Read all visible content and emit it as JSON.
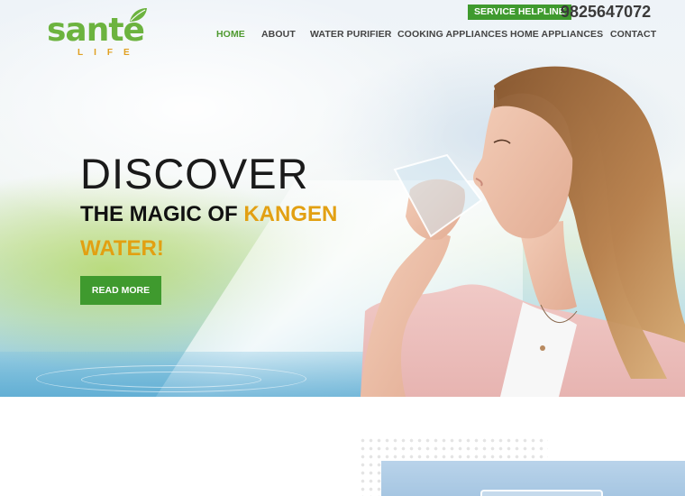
{
  "brand": {
    "name": "santé",
    "subtitle": "LIFE",
    "colors": {
      "green": "#6cb33f",
      "orange": "#e0a020"
    }
  },
  "helpline": {
    "label": "SERVICE HELPLINE",
    "number": "9825647072"
  },
  "nav": {
    "items": [
      {
        "label": "HOME",
        "active": true
      },
      {
        "label": "ABOUT",
        "active": false
      },
      {
        "label": "WATER PURIFIER",
        "active": false
      },
      {
        "label": "COOKING APPLIANCES",
        "active": false
      },
      {
        "label": "HOME APPLIANCES",
        "active": false
      },
      {
        "label": "CONTACT",
        "active": false
      }
    ]
  },
  "hero": {
    "heading": "DISCOVER",
    "line2_prefix": "THE MAGIC OF",
    "line2_accent": "KANGEN",
    "line3": "WATER!",
    "cta_label": "READ MORE",
    "image": "woman-drinking-water"
  },
  "theme": {
    "primary_green": "#3f9a2e",
    "accent_orange": "#e2a012",
    "nav_active": "#4f9a30"
  }
}
